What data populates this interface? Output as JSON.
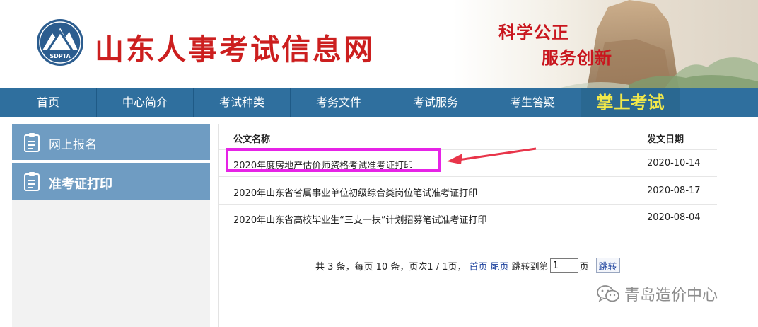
{
  "header": {
    "site_title": "山东人事考试信息网",
    "logo_text": "SDPTA",
    "slogan_line1": "科学公正",
    "slogan_line2": "服务创新"
  },
  "nav": {
    "items": [
      "首页",
      "中心简介",
      "考试种类",
      "考务文件",
      "考试服务",
      "考生答疑"
    ],
    "mobile": "掌上考试"
  },
  "sidebar": {
    "items": [
      {
        "label": "网上报名",
        "icon": "clipboard-icon"
      },
      {
        "label": "准考证打印",
        "icon": "clipboard-icon"
      }
    ]
  },
  "table": {
    "headers": {
      "name": "公文名称",
      "date": "发文日期"
    },
    "rows": [
      {
        "title": "2020年度房地产估价师资格考试准考证打印",
        "date": "2020-10-14"
      },
      {
        "title": "2020年山东省省属事业单位初级综合类岗位笔试准考证打印",
        "date": "2020-08-17"
      },
      {
        "title": "2020年山东省高校毕业生“三支一扶”计划招募笔试准考证打印",
        "date": "2020-08-04"
      }
    ]
  },
  "pager": {
    "summary": "共 3 条，每页 10 条，页次1 / 1页，",
    "first": "首页",
    "last": "尾页",
    "jump_label": "跳转到第",
    "page_value": "1",
    "page_suffix": "页",
    "go": "跳转"
  },
  "watermark": {
    "text": "青岛造价中心"
  },
  "colors": {
    "nav_bg": "#2f6f9e",
    "sidebar_bg": "#6f9cc2",
    "title_red": "#cc1f1f",
    "highlight": "#e623e6",
    "arrow": "#e8354a",
    "mobile_text": "#f2e84a"
  }
}
